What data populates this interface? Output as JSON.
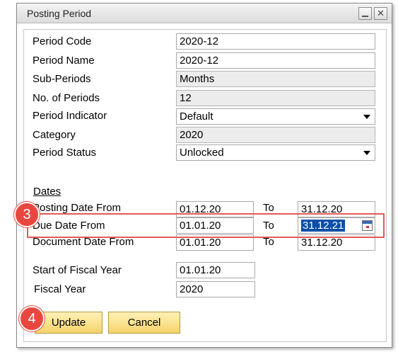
{
  "window": {
    "title": "Posting Period",
    "minimize_icon": "minimize-icon",
    "close_icon": "close-icon",
    "close_glyph": "✕"
  },
  "fields": {
    "period_code": {
      "label": "Period Code",
      "value": "2020-12"
    },
    "period_name": {
      "label": "Period Name",
      "value": "2020-12"
    },
    "sub_periods": {
      "label": "Sub-Periods",
      "value": "Months"
    },
    "no_of_periods": {
      "label": "No. of Periods",
      "value": "12"
    },
    "period_indicator": {
      "label": "Period Indicator",
      "value": "Default"
    },
    "category": {
      "label": "Category",
      "value": "2020"
    },
    "period_status": {
      "label": "Period Status",
      "value": "Unlocked"
    }
  },
  "dates": {
    "section_title": "Dates",
    "to_label": "To",
    "posting": {
      "label": "Posting Date From",
      "from": "01.12.20",
      "to": "31.12.20"
    },
    "due": {
      "label": "Due Date From",
      "from": "01.01.20",
      "to": "31.12.21"
    },
    "document": {
      "label": "Document Date From",
      "from": "01.01.20",
      "to": "31.12.20"
    }
  },
  "fiscal": {
    "start": {
      "label": "Start of Fiscal Year",
      "value": "01.01.20"
    },
    "year": {
      "label": "Fiscal Year",
      "value": "2020"
    }
  },
  "buttons": {
    "update": "Update",
    "cancel": "Cancel"
  },
  "annotations": {
    "step3": "3",
    "step4": "4",
    "highlight_color": "#e25a5a",
    "badge_color": "#e8473f"
  }
}
